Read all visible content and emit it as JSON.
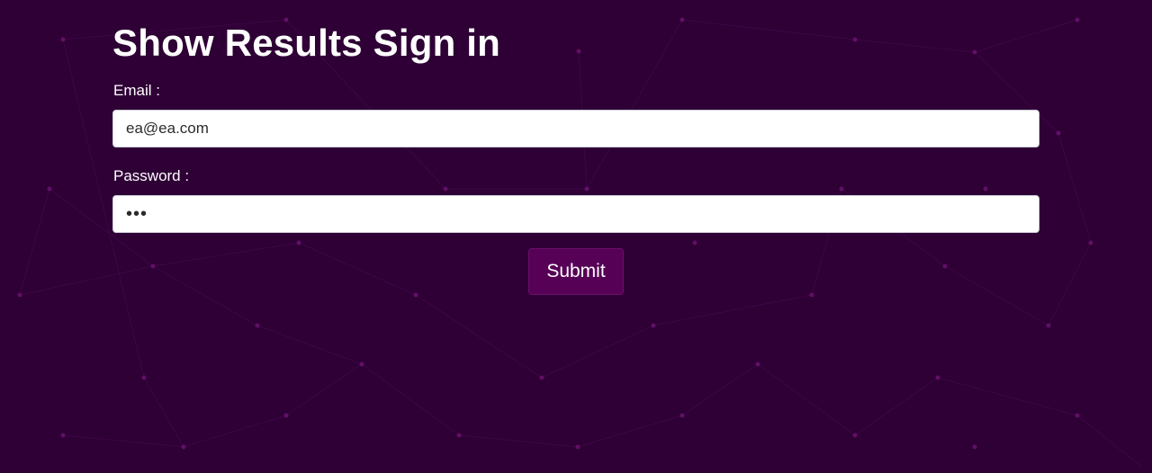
{
  "page": {
    "title": "Show Results Sign in",
    "background_color": "#2e0035",
    "accent_color": "#560056"
  },
  "form": {
    "email_label": "Email :",
    "email_value": "ea@ea.com",
    "password_label": "Password :",
    "password_value": "abc",
    "submit_label": "Submit"
  }
}
